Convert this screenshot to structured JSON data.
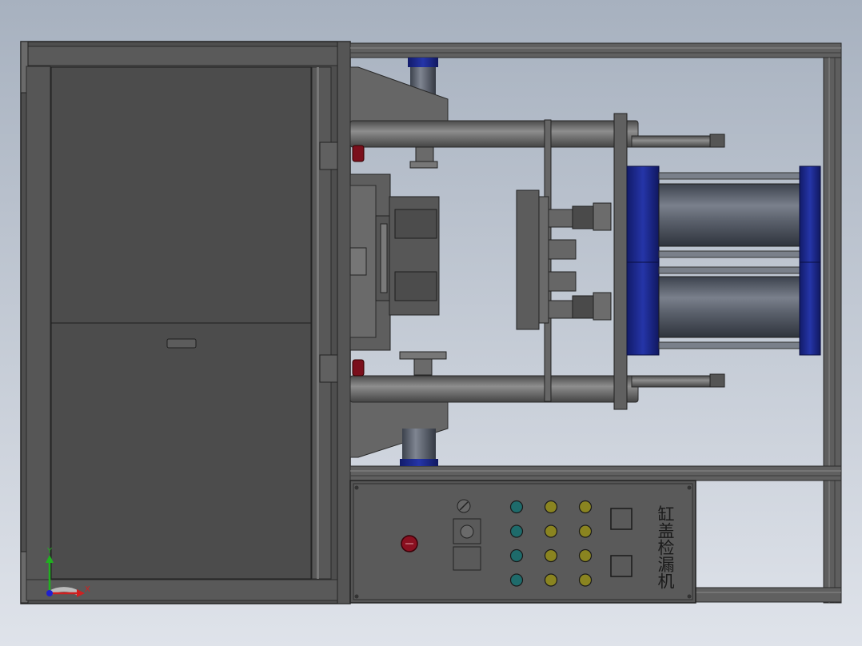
{
  "viewport": {
    "background_top": "#a7b1bf",
    "background_bottom": "#dfe3ea"
  },
  "colors": {
    "frame": "#5c5c5c",
    "frame_dark": "#333333",
    "frame_light": "#8c8c8c",
    "cylinder_blue": "#1c2a8c",
    "cylinder_body": "#5f6570",
    "rod": "#707070",
    "red_button": "#8a1020",
    "indicator_teal": "#1e6b6b",
    "indicator_yellow": "#8a8420",
    "axis_y": "#20b020",
    "axis_x": "#d02020",
    "axis_origin": "#2020d0"
  },
  "control_panel": {
    "title": "缸盖检漏机",
    "indicator_rows": 4,
    "knob_icon": "knob-icon",
    "estop_icon": "emergency-stop-icon"
  },
  "triad": {
    "y_label": "Y",
    "x_label": "X"
  }
}
